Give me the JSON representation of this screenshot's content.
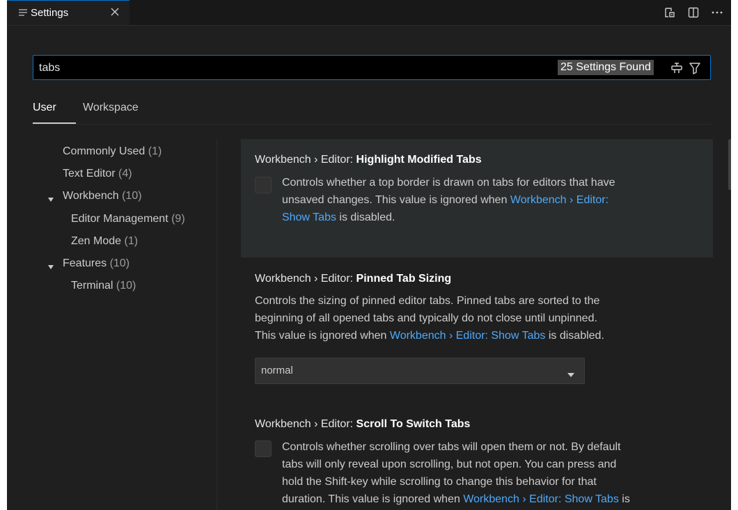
{
  "tab": {
    "label": "Settings",
    "icon": "settings-list-icon",
    "close_icon": "close-icon"
  },
  "toolbar": {
    "icons": [
      "open-settings-json-icon",
      "split-editor-icon",
      "more-actions-icon"
    ]
  },
  "search": {
    "value": "tabs",
    "count_text": "25 Settings Found",
    "icons": [
      "clear-filter-icon",
      "filter-icon"
    ]
  },
  "scopes": {
    "user": "User",
    "workspace": "Workspace",
    "active": "User"
  },
  "tree": {
    "commonly_used": {
      "label": "Commonly Used",
      "count": "(1)"
    },
    "text_editor": {
      "label": "Text Editor",
      "count": "(4)"
    },
    "workbench": {
      "label": "Workbench",
      "count": "(10)",
      "expanded": true
    },
    "editor_management": {
      "label": "Editor Management",
      "count": "(9)"
    },
    "zen_mode": {
      "label": "Zen Mode",
      "count": "(1)"
    },
    "features": {
      "label": "Features",
      "count": "(10)",
      "expanded": true
    },
    "terminal": {
      "label": "Terminal",
      "count": "(10)"
    }
  },
  "settings": {
    "highlight": {
      "category": "Workbench › Editor: ",
      "name": "Highlight Modified Tabs",
      "desc_line1": "Controls whether a top border is drawn on tabs for editors that have",
      "desc_line2_pre": "unsaved changes. This value is ignored when ",
      "desc_line2_link": "Workbench › Editor:",
      "desc_line3_link": "Show Tabs",
      "desc_line3_post": " is disabled.",
      "checked": false
    },
    "pinned": {
      "category": "Workbench › Editor: ",
      "name": "Pinned Tab Sizing",
      "desc_line1": "Controls the sizing of pinned editor tabs. Pinned tabs are sorted to the",
      "desc_line2": "beginning of all opened tabs and typically do not close until unpinned.",
      "desc_line3_pre": "This value is ignored when ",
      "desc_line3_link": "Workbench › Editor: Show Tabs",
      "desc_line3_post": " is disabled.",
      "select_value": "normal"
    },
    "scroll": {
      "category": "Workbench › Editor: ",
      "name": "Scroll To Switch Tabs",
      "desc_line1": "Controls whether scrolling over tabs will open them or not. By default",
      "desc_line2": "tabs will only reveal upon scrolling, but not open. You can press and",
      "desc_line3": "hold the Shift-key while scrolling to change this behavior for that",
      "desc_line4_pre": "duration. This value is ignored when ",
      "desc_line4_link": "Workbench › Editor: Show Tabs",
      "desc_line4_post": " is",
      "checked": false
    }
  },
  "colors": {
    "accent": "#0078d4",
    "link": "#4daafc",
    "background": "#1f1f1f",
    "hover_row": "#2a2d2e"
  }
}
